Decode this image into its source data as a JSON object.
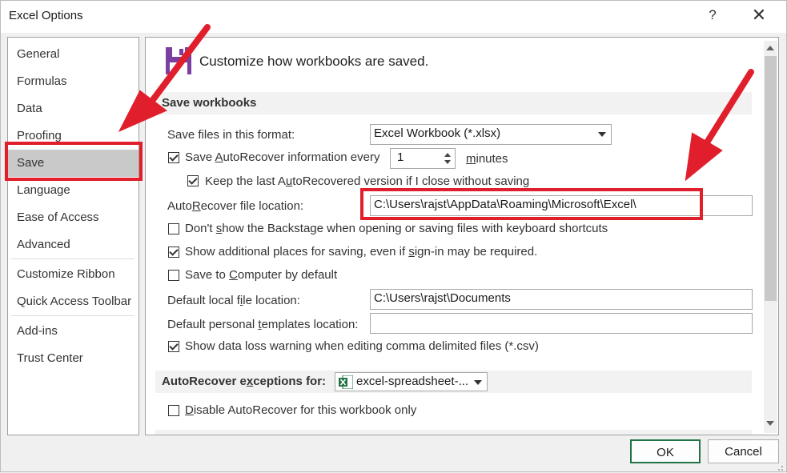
{
  "window": {
    "title": "Excel Options",
    "help_icon": "?",
    "close_icon": "✕"
  },
  "sidebar": {
    "items": [
      {
        "label": "General"
      },
      {
        "label": "Formulas"
      },
      {
        "label": "Data"
      },
      {
        "label": "Proofing"
      },
      {
        "label": "Save",
        "selected": true
      },
      {
        "label": "Language"
      },
      {
        "label": "Ease of Access"
      },
      {
        "label": "Advanced"
      },
      {
        "label": "Customize Ribbon"
      },
      {
        "label": "Quick Access Toolbar"
      },
      {
        "label": "Add-ins"
      },
      {
        "label": "Trust Center"
      }
    ]
  },
  "main": {
    "heading": "Customize how workbooks are saved.",
    "section_save": "Save workbooks",
    "save_format_label": "Save files in this format:",
    "save_format_value": "Excel Workbook (*.xlsx)",
    "autorecover_label": "Save AutoRecover information every",
    "autorecover_minutes": "1",
    "minutes_label": "minutes",
    "keep_last_label": "Keep the last AutoRecovered version if I close without saving",
    "autorecover_location_label": "AutoRecover file location:",
    "autorecover_location_value": "C:\\Users\\rajst\\AppData\\Roaming\\Microsoft\\Excel\\",
    "backstage_label": "Don't show the Backstage when opening or saving files with keyboard shortcuts",
    "additional_places_label": "Show additional places for saving, even if sign-in may be required.",
    "save_to_computer_label": "Save to Computer by default",
    "default_local_label": "Default local file location:",
    "default_local_value": "C:\\Users\\rajst\\Documents",
    "default_templates_label": "Default personal templates location:",
    "default_templates_value": "",
    "data_loss_label": "Show data loss warning when editing comma delimited files (*.csv)",
    "section_exceptions": "AutoRecover exceptions for:",
    "exceptions_workbook": "excel-spreadsheet-...",
    "disable_autorecover_label": "Disable AutoRecover for this workbook only"
  },
  "buttons": {
    "ok": "OK",
    "cancel": "Cancel"
  },
  "colors": {
    "annotation_red": "#e11f2c",
    "excel_green": "#217346",
    "save_icon_purple": "#7b3fa0"
  }
}
